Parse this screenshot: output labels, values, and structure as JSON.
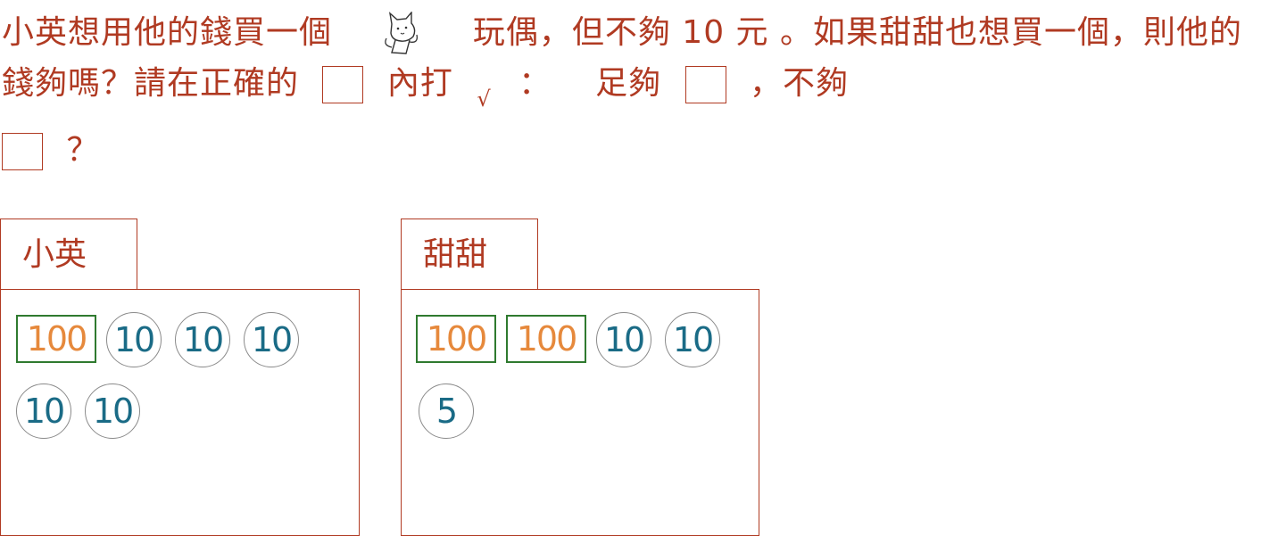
{
  "question": {
    "seg1": "小英想用他的錢買一個",
    "seg2": "玩偶，但不夠",
    "amount": "10 元",
    "seg3": "。如果甜甜也想買一個，則他的錢夠嗎？請在正確的",
    "seg4": "內打",
    "check_mark": "√",
    "seg5": "：",
    "option_enough": "足夠",
    "seg6": "，不夠",
    "end_mark": "？"
  },
  "panels": [
    {
      "name": "小英",
      "money": [
        {
          "kind": "note",
          "value": "100"
        },
        {
          "kind": "coin",
          "value": "10"
        },
        {
          "kind": "coin",
          "value": "10"
        },
        {
          "kind": "coin",
          "value": "10"
        },
        {
          "kind": "coin",
          "value": "10"
        },
        {
          "kind": "coin",
          "value": "10"
        }
      ]
    },
    {
      "name": "甜甜",
      "money": [
        {
          "kind": "note",
          "value": "100"
        },
        {
          "kind": "note",
          "value": "100"
        },
        {
          "kind": "coin",
          "value": "10"
        },
        {
          "kind": "coin",
          "value": "10"
        },
        {
          "kind": "coin",
          "value": "5"
        }
      ]
    }
  ],
  "colors": {
    "text": "#b03a22",
    "note_border": "#2f7a2f",
    "note_text": "#e6893c",
    "coin_text": "#1a6b86"
  }
}
